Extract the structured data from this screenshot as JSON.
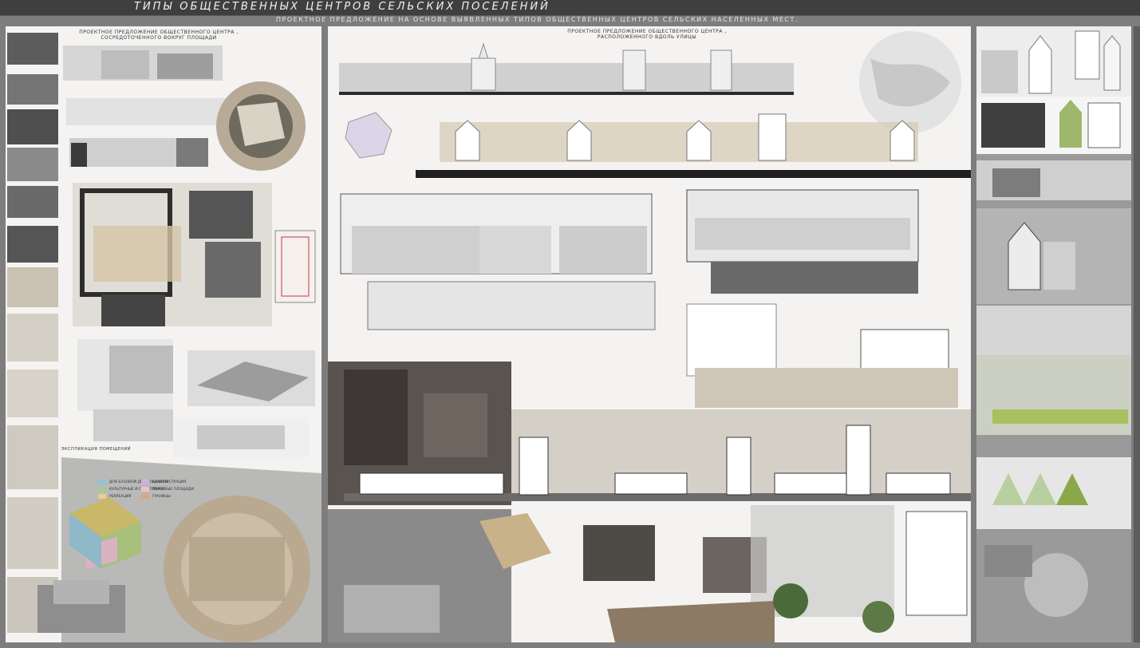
{
  "poster": {
    "title": "ТИПЫ ОБЩЕСТВЕННЫХ ЦЕНТРОВ СЕЛЬСКИХ ПОСЕЛЕНИЙ",
    "subtitle": "ПРОЕКТНОЕ ПРЕДЛОЖЕНИЕ НА ОСНОВЕ ВЫЯВЛЕННЫХ ТИПОВ ОБЩЕСТВЕННЫХ ЦЕНТРОВ СЕЛЬСКИХ НАСЕЛЕННЫХ МЕСТ."
  },
  "left_panel": {
    "heading_line1": "ПРОЕКТНОЕ ПРЕДЛОЖЕНИЕ ОБЩЕСТВЕННОГО ЦЕНТРА ,",
    "heading_line2": "СОСРЕДОТОЧЕННОГО ВОКРУГ ПЛОЩАДИ",
    "legend_title": "ЭКСПЛИКАЦИЯ ПОМЕЩЕНИЙ",
    "legend_items": [
      {
        "label": "ДЛЯ БАЗОВОЙ ДЕЯТЕЛЬНОСТИ",
        "color": "#8fc4d8"
      },
      {
        "label": "АДМИНИСТРАЦИЯ",
        "color": "#c9b3e0"
      },
      {
        "label": "КУЛЬТУРНЫЕ И СПОРТИВНЫЕ",
        "color": "#a9c98f"
      },
      {
        "label": "ТОРГОВЫЕ ПЛОЩАДИ",
        "color": "#f0c0c8"
      },
      {
        "label": "РЕКРЕАЦИЯ",
        "color": "#e8d08a"
      },
      {
        "label": "ГРАНИЦЫ",
        "color": "#d9a77a"
      }
    ]
  },
  "center_panel": {
    "heading_line1": "ПРОЕКТНОЕ ПРЕДЛОЖЕНИЕ ОБЩЕСТВЕННОГО ЦЕНТРА ,",
    "heading_line2": "РАСПОЛОЖЕННОГО ВДОЛЬ УЛИЦЫ"
  },
  "colors": {
    "background": "#7d7d7d",
    "topbar": "#3f3f3f",
    "panel": "#f4f3f1",
    "accent_beige": "#d8c8b0",
    "accent_green": "#8aa84a"
  }
}
